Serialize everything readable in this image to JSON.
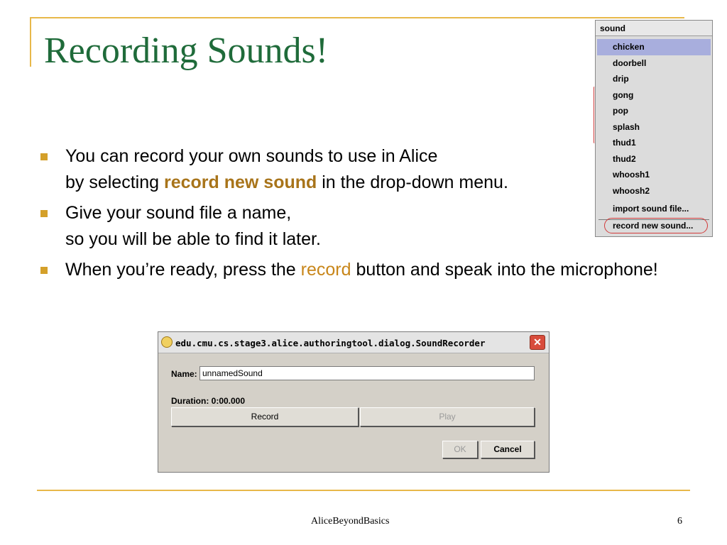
{
  "title": "Recording Sounds!",
  "bullets": [
    {
      "line1": "You can record your own sounds to use in Alice",
      "line2_pre": "by selecting ",
      "line2_highlight": "record new sound",
      "line2_post": " in the drop-down menu."
    },
    {
      "line1": "Give your sound file a name,",
      "line2": "so you will be able to find it later."
    },
    {
      "pre": "When you’re ready, press the ",
      "highlight": "record",
      "post": " button and speak into the microphone!"
    }
  ],
  "sound_menu": {
    "header": "sound",
    "items": [
      "chicken",
      "doorbell",
      "drip",
      "gong",
      "pop",
      "splash",
      "thud1",
      "thud2",
      "whoosh1",
      "whoosh2"
    ],
    "selected": "chicken",
    "import_label": "import sound file...",
    "record_label": "record new sound..."
  },
  "dialog": {
    "title": "edu.cmu.cs.stage3.alice.authoringtool.dialog.SoundRecorder",
    "close_label": "✕",
    "name_label": "Name:",
    "name_value": "unnamedSound",
    "duration_label": "Duration: 0:00.000",
    "record_button": "Record",
    "play_button": "Play",
    "ok_button": "OK",
    "cancel_button": "Cancel"
  },
  "footer": {
    "text": "AliceBeyondBasics",
    "page": "6"
  },
  "colors": {
    "title": "#1f6b3a",
    "accent": "#d4a02a",
    "highlight": "#a8741a"
  }
}
